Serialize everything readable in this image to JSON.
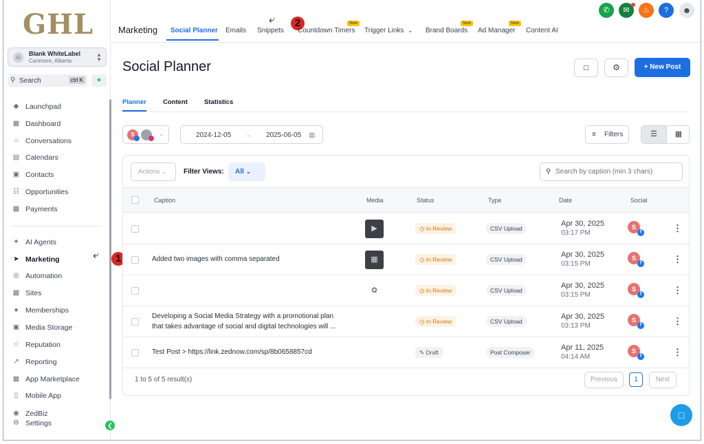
{
  "logo_text": "GHL",
  "account": {
    "name": "Blank WhiteLabel",
    "location": "Canmore, Alberta"
  },
  "search": {
    "label": "Search",
    "shortcut": "ctrl K"
  },
  "sidebar": {
    "items": [
      {
        "label": "Launchpad",
        "icon": "rocket-icon"
      },
      {
        "label": "Dashboard",
        "icon": "grid-icon"
      },
      {
        "label": "Conversations",
        "icon": "chat-icon"
      },
      {
        "label": "Calendars",
        "icon": "calendar-icon"
      },
      {
        "label": "Contacts",
        "icon": "contacts-icon"
      },
      {
        "label": "Opportunities",
        "icon": "funnel-icon"
      },
      {
        "label": "Payments",
        "icon": "payments-icon"
      },
      {
        "label": "AI Agents",
        "icon": "sparkle-icon"
      },
      {
        "label": "Marketing",
        "icon": "send-icon",
        "active": true
      },
      {
        "label": "Automation",
        "icon": "automation-icon"
      },
      {
        "label": "Sites",
        "icon": "sites-icon"
      },
      {
        "label": "Memberships",
        "icon": "memberships-icon"
      },
      {
        "label": "Media Storage",
        "icon": "media-icon"
      },
      {
        "label": "Reputation",
        "icon": "star-icon"
      },
      {
        "label": "Reporting",
        "icon": "chart-icon"
      },
      {
        "label": "App Marketplace",
        "icon": "apps-icon"
      },
      {
        "label": "Mobile App",
        "icon": "mobile-icon"
      },
      {
        "label": "ZedBiz",
        "icon": "zedbiz-icon"
      },
      {
        "label": "Settings",
        "icon": "gear-icon"
      }
    ]
  },
  "annotations": {
    "one": "1",
    "two": "2"
  },
  "header": {
    "section": "Marketing",
    "tabs": [
      {
        "label": "Social Planner",
        "active": true
      },
      {
        "label": "Emails"
      },
      {
        "label": "Snippets"
      },
      {
        "label": "Countdown Timers",
        "tag": "New"
      },
      {
        "label": "Trigger Links"
      },
      {
        "label": "Brand Boards",
        "tag": "New"
      },
      {
        "label": "Ad Manager",
        "tag": "New"
      },
      {
        "label": "Content AI"
      }
    ]
  },
  "top_icons": [
    {
      "name": "phone-icon",
      "color": "#16a34a"
    },
    {
      "name": "megaphone-icon",
      "color": "#15803d"
    },
    {
      "name": "bell-icon",
      "color": "#f97316"
    },
    {
      "name": "help-icon",
      "color": "#1d6fe0"
    }
  ],
  "main": {
    "title": "Social Planner",
    "new_post_label": "New Post",
    "subtabs": [
      "Planner",
      "Content",
      "Statistics"
    ],
    "date_from": "2024-12-05",
    "date_to": "2025-06-05",
    "filters_label": "Filters",
    "actions_label": "Actions",
    "filter_views_label": "Filter Views:",
    "filter_view_value": "All",
    "search_placeholder": "Search by caption (min 3 chars)",
    "columns": [
      "Caption",
      "Media",
      "Status",
      "Type",
      "Date",
      "Social"
    ],
    "rows": [
      {
        "caption1": "",
        "caption2": "",
        "status": "In Review",
        "type": "CSV Upload",
        "date": "Apr 30, 2025",
        "time": "03:17 PM",
        "social": "S"
      },
      {
        "caption1": "Added two images with comma separated",
        "caption2": "",
        "status": "In Review",
        "type": "CSV Upload",
        "date": "Apr 30, 2025",
        "time": "03:15 PM",
        "social": "S"
      },
      {
        "caption1": "",
        "caption2": "",
        "status": "In Review",
        "type": "CSV Upload",
        "date": "Apr 30, 2025",
        "time": "03:15 PM",
        "social": "S"
      },
      {
        "caption1": "Developing a Social Media Strategy with a promotional plan",
        "caption2": "that takes advantage of social and digital technologies will ...",
        "status": "In Review",
        "type": "CSV Upload",
        "date": "Apr 30, 2025",
        "time": "03:13 PM",
        "social": "S"
      },
      {
        "caption1": "Test Post > https://link.zednow.com/sp/8b0658857cd",
        "caption2": "",
        "status": "Draft",
        "type": "Post Composer",
        "date": "Apr 11, 2025",
        "time": "04:14 AM",
        "social": "S"
      }
    ],
    "pagination": {
      "summary": "1 to 5 of 5 result(s)",
      "previous": "Previous",
      "current": "1",
      "next": "Next"
    }
  }
}
